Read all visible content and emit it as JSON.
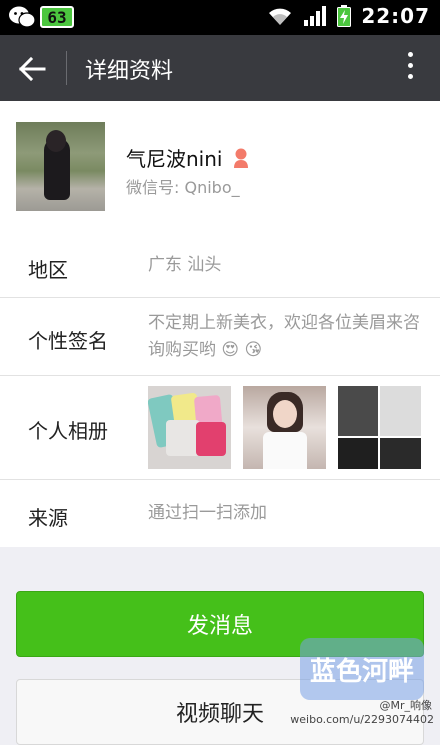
{
  "statusbar": {
    "badge": "63",
    "time": "22:07"
  },
  "actionbar": {
    "title": "详细资料"
  },
  "profile": {
    "nickname": "气尼波nini",
    "wechat_id": "微信号: Qnibo_"
  },
  "details": {
    "region": {
      "label": "地区",
      "value": "广东  汕头"
    },
    "signature": {
      "label": "个性签名",
      "value": "不定期上新美衣，欢迎各位美眉来咨询购买哟 😍 😘"
    },
    "album": {
      "label": "个人相册"
    },
    "source": {
      "label": "来源",
      "value": "通过扫一扫添加"
    }
  },
  "buttons": {
    "send": "发消息",
    "video": "视频聊天"
  },
  "watermark": {
    "logo": "蓝色河畔",
    "credit": "@Mr_响像",
    "url": "weibo.com/u/2293074402"
  },
  "colors": {
    "accent_green": "#45c01a",
    "actionbar": "#393a3f",
    "statusbar": "#000000"
  }
}
